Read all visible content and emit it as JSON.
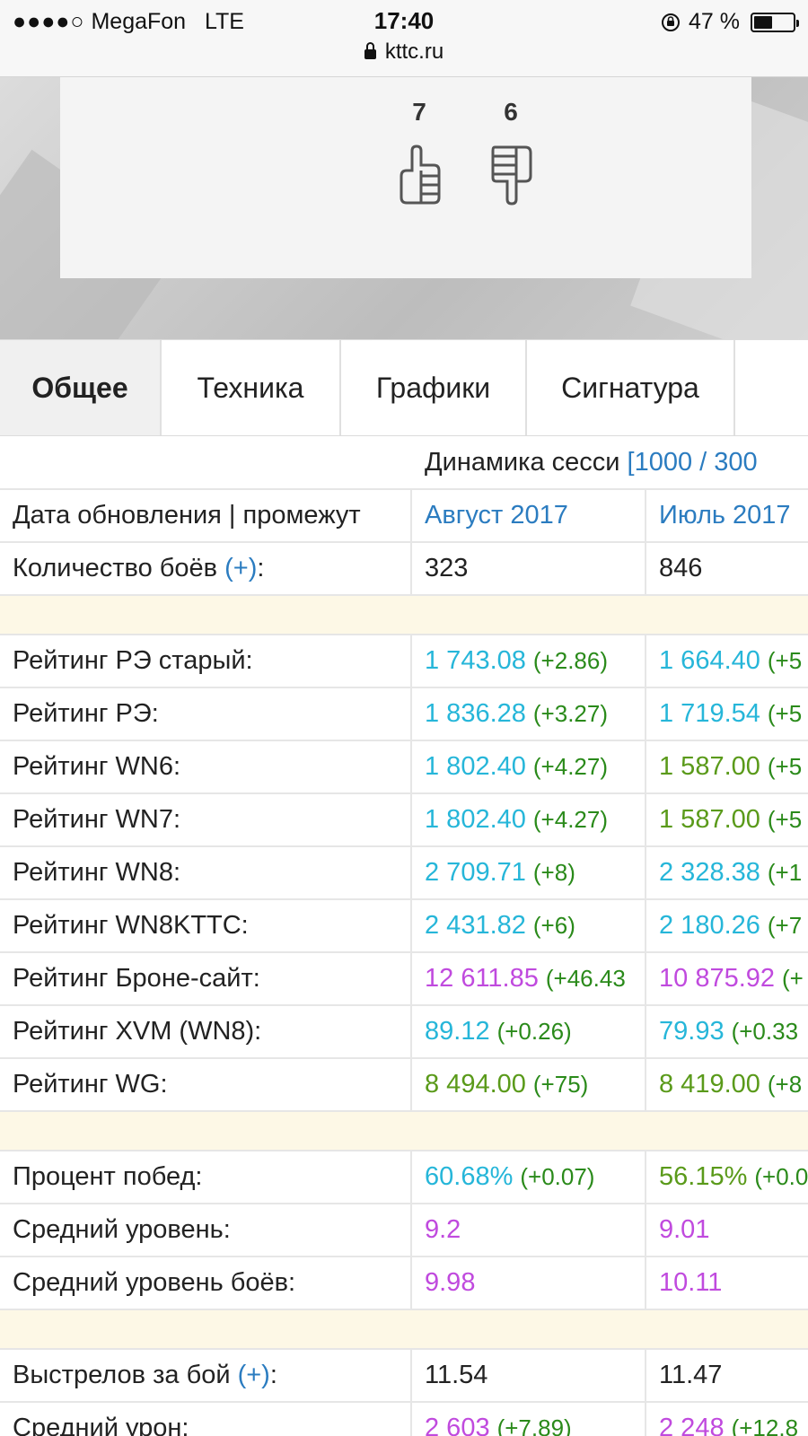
{
  "status_bar": {
    "signal_dots": "●●●●○",
    "carrier": "MegaFon",
    "network": "LTE",
    "time": "17:40",
    "battery": "47 %",
    "battery_level": 0.47,
    "url": "kttc.ru"
  },
  "votes": {
    "likes": "7",
    "dislikes": "6"
  },
  "tabs": [
    {
      "label": "Общее",
      "active": true
    },
    {
      "label": "Техника",
      "active": false
    },
    {
      "label": "Графики",
      "active": false
    },
    {
      "label": "Сигнатура",
      "active": false
    }
  ],
  "table": {
    "header_text": "Динамика сесси",
    "header_link": "[1000 / 300",
    "date_row": {
      "label": "Дата обновления | промежут",
      "col1": "Август 2017",
      "col2": "Июль 2017"
    },
    "battles_row": {
      "label_pre": "Количество боёв ",
      "label_link": "(+)",
      "label_post": ":",
      "col1": "323",
      "col2": "846"
    },
    "ratings": [
      {
        "label": "Рейтинг РЭ старый:",
        "v1": "1 743.08",
        "d1": "(+2.86)",
        "c1": "cyan",
        "v2": "1 664.40",
        "d2": "(+5",
        "c2": "cyan"
      },
      {
        "label": "Рейтинг РЭ:",
        "v1": "1 836.28",
        "d1": "(+3.27)",
        "c1": "cyan",
        "v2": "1 719.54",
        "d2": "(+5",
        "c2": "cyan"
      },
      {
        "label": "Рейтинг WN6:",
        "v1": "1 802.40",
        "d1": "(+4.27)",
        "c1": "cyan",
        "v2": "1 587.00",
        "d2": "(+5",
        "c2": "green"
      },
      {
        "label": "Рейтинг WN7:",
        "v1": "1 802.40",
        "d1": "(+4.27)",
        "c1": "cyan",
        "v2": "1 587.00",
        "d2": "(+5",
        "c2": "green"
      },
      {
        "label": "Рейтинг WN8:",
        "v1": "2 709.71",
        "d1": "(+8)",
        "c1": "cyan",
        "v2": "2 328.38",
        "d2": "(+1",
        "c2": "cyan"
      },
      {
        "label": "Рейтинг WN8KTTC:",
        "v1": "2 431.82",
        "d1": "(+6)",
        "c1": "cyan",
        "v2": "2 180.26",
        "d2": "(+7",
        "c2": "cyan"
      },
      {
        "label": "Рейтинг Броне-сайт:",
        "v1": "12 611.85",
        "d1": "(+46.43",
        "c1": "magenta",
        "v2": "10 875.92",
        "d2": "(+",
        "c2": "magenta"
      },
      {
        "label": "Рейтинг XVM (WN8):",
        "v1": "89.12",
        "d1": "(+0.26)",
        "c1": "cyan",
        "v2": "79.93",
        "d2": "(+0.33",
        "c2": "cyan"
      },
      {
        "label": "Рейтинг WG:",
        "v1": "8 494.00",
        "d1": "(+75)",
        "c1": "green",
        "v2": "8 419.00",
        "d2": "(+8",
        "c2": "green"
      }
    ],
    "stats": [
      {
        "label": "Процент побед:",
        "v1": "60.68%",
        "d1": "(+0.07)",
        "c1": "cyan",
        "v2": "56.15%",
        "d2": "(+0.0",
        "c2": "green"
      },
      {
        "label": "Средний уровень:",
        "v1": "9.2",
        "d1": "",
        "c1": "magenta",
        "v2": "9.01",
        "d2": "",
        "c2": "magenta"
      },
      {
        "label": "Средний уровень боёв:",
        "v1": "9.98",
        "d1": "",
        "c1": "magenta",
        "v2": "10.11",
        "d2": "",
        "c2": "magenta"
      }
    ],
    "shots_row": {
      "label_pre": "Выстрелов за бой ",
      "label_link": "(+)",
      "label_post": ":",
      "v1": "11.54",
      "v2": "11.47"
    },
    "damage_row": {
      "label": "Средний урон:",
      "v1": "2 603",
      "d1": "(+7.89)",
      "c1": "magenta",
      "v2": "2 248",
      "d2": "(+12.8",
      "c2": "magenta"
    }
  },
  "colors": {
    "link": "#2b7cc0",
    "cyan": "#26b6d9",
    "green": "#5a9a1a",
    "magenta": "#c04ade",
    "delta_green": "#2a8a1a",
    "spacer": "#fdf8e6"
  }
}
